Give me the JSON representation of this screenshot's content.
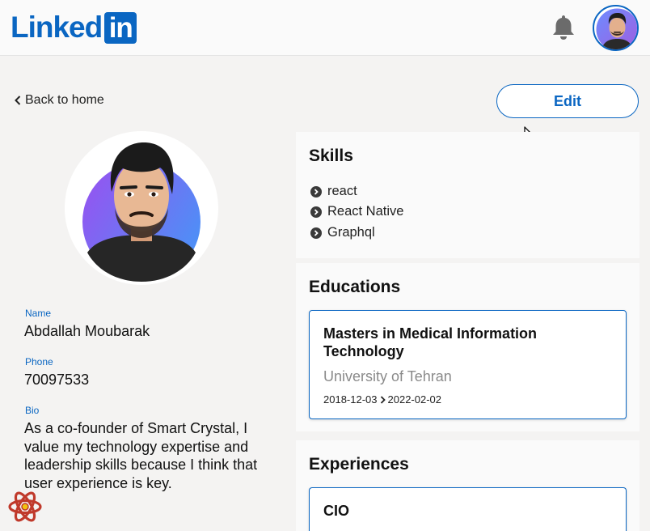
{
  "header": {
    "logo_text": "Linked",
    "logo_box_text": "in"
  },
  "nav": {
    "back_label": "Back to home",
    "edit_label": "Edit"
  },
  "profile": {
    "fields": {
      "name_label": "Name",
      "name_value": "Abdallah Moubarak",
      "phone_label": "Phone",
      "phone_value": "70097533",
      "bio_label": "Bio",
      "bio_value": "As a co-founder of Smart Crystal, I value my technology expertise and leadership skills because I think that user experience is key."
    }
  },
  "skills": {
    "title": "Skills",
    "items": [
      "react",
      "React Native",
      "Graphql"
    ]
  },
  "educations": {
    "title": "Educations",
    "items": [
      {
        "degree": "Masters in Medical Information Technology",
        "school": "University of Tehran",
        "start": "2018-12-03",
        "end": "2022-02-02"
      }
    ]
  },
  "experiences": {
    "title": "Experiences",
    "items": [
      {
        "role": "CIO"
      }
    ]
  },
  "colors": {
    "brand": "#0a66c2",
    "background": "#f4f3f2",
    "card": "#fafafa"
  }
}
